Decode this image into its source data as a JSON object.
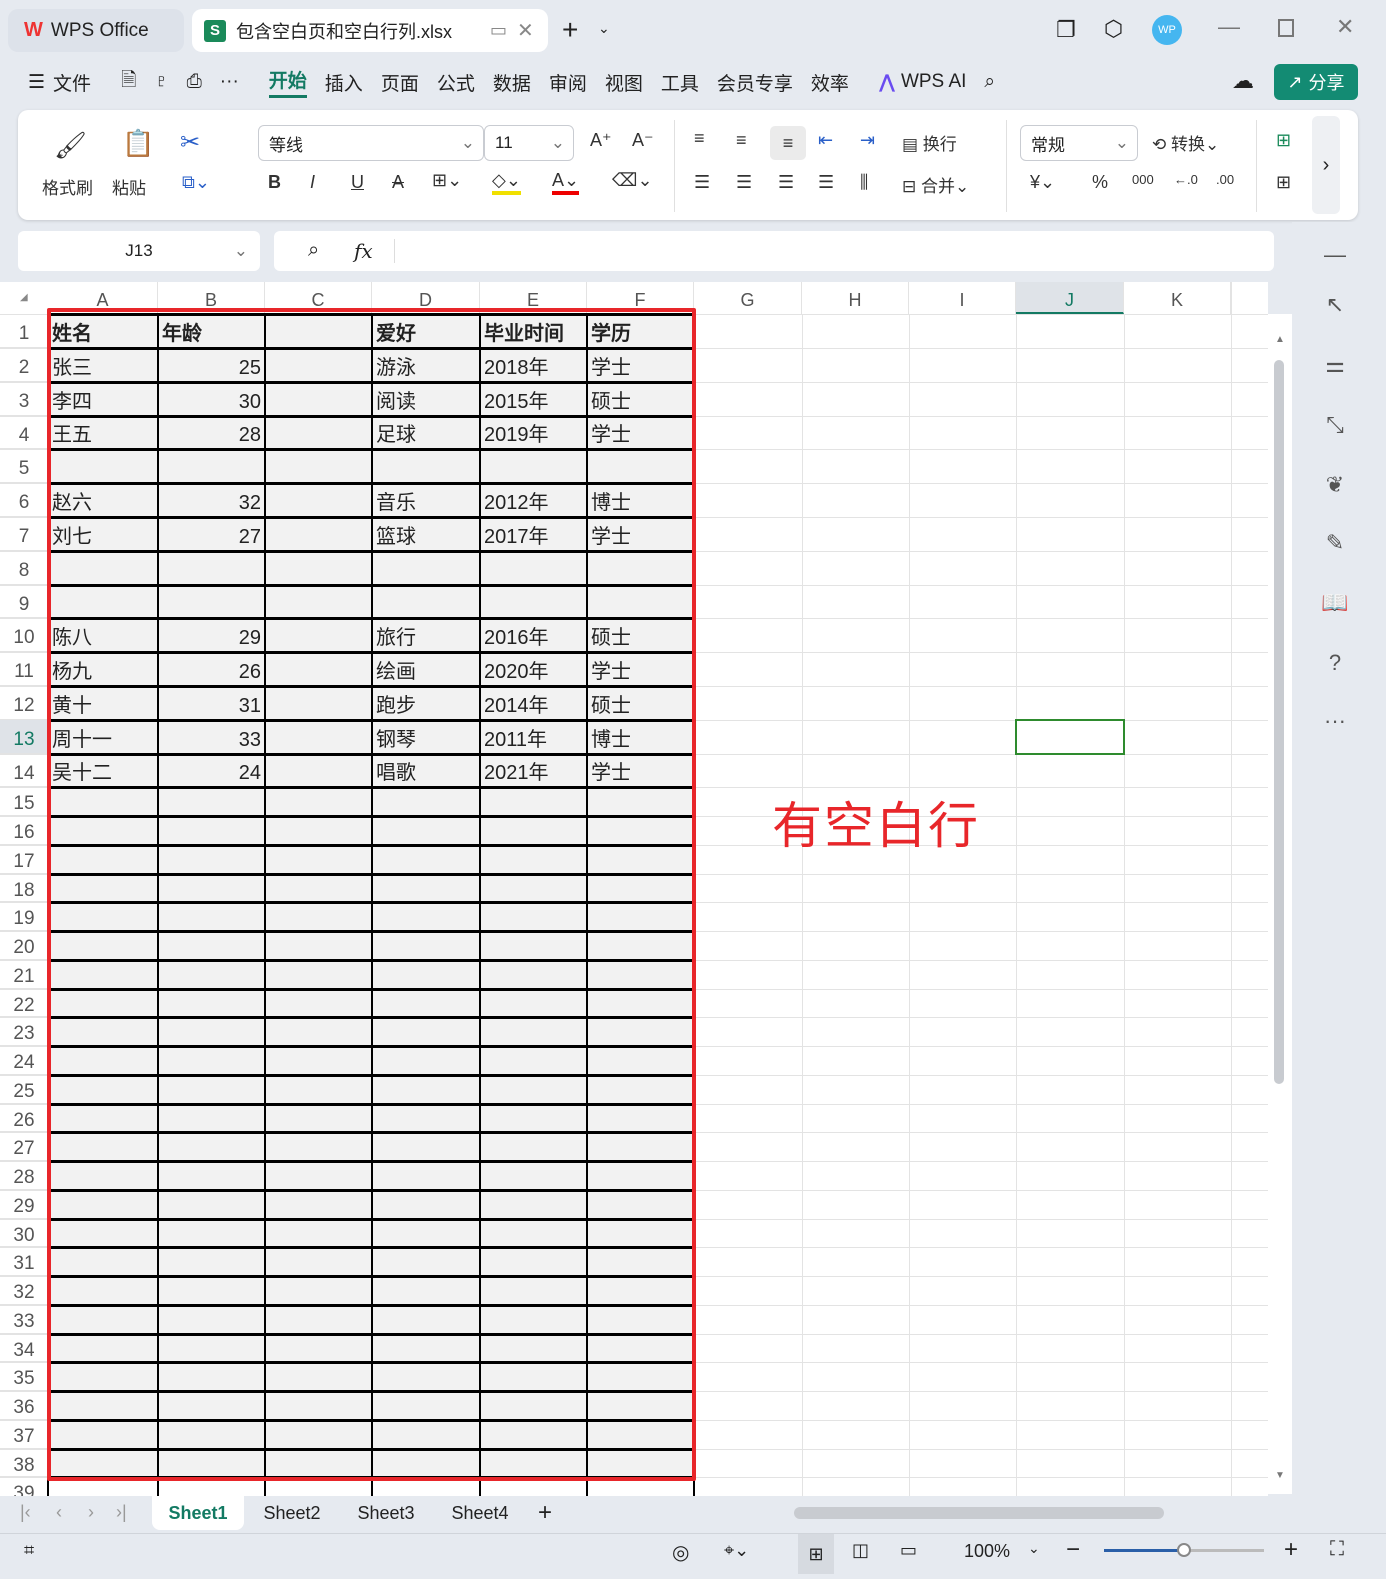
{
  "titlebar": {
    "home_tab": "WPS Office",
    "doc_tab": "包含空白页和空白行列.xlsx",
    "avatar": "WP"
  },
  "menu": {
    "file": "文件",
    "tabs": [
      "开始",
      "插入",
      "页面",
      "公式",
      "数据",
      "审阅",
      "视图",
      "工具",
      "会员专享",
      "效率"
    ],
    "ai": "WPS AI",
    "share": "分享"
  },
  "ribbon": {
    "format_painter": "格式刷",
    "paste": "粘贴",
    "font": "等线",
    "size": "11",
    "wrap": "换行",
    "merge": "合并",
    "number_format": "常规",
    "convert": "转换"
  },
  "formula_bar": {
    "cell_ref": "J13",
    "fx": "fx",
    "value": ""
  },
  "columns": [
    "A",
    "B",
    "C",
    "D",
    "E",
    "F",
    "G",
    "H",
    "I",
    "J",
    "K"
  ],
  "selected_cell": "J13",
  "rows": [
    [
      "姓名",
      "年龄",
      "",
      "爱好",
      "毕业时间",
      "学历"
    ],
    [
      "张三",
      "25",
      "",
      "游泳",
      "2018年",
      "学士"
    ],
    [
      "李四",
      "30",
      "",
      "阅读",
      "2015年",
      "硕士"
    ],
    [
      "王五",
      "28",
      "",
      "足球",
      "2019年",
      "学士"
    ],
    [
      "",
      "",
      "",
      "",
      "",
      ""
    ],
    [
      "赵六",
      "32",
      "",
      "音乐",
      "2012年",
      "博士"
    ],
    [
      "刘七",
      "27",
      "",
      "篮球",
      "2017年",
      "学士"
    ],
    [
      "",
      "",
      "",
      "",
      "",
      ""
    ],
    [
      "",
      "",
      "",
      "",
      "",
      ""
    ],
    [
      "陈八",
      "29",
      "",
      "旅行",
      "2016年",
      "硕士"
    ],
    [
      "杨九",
      "26",
      "",
      "绘画",
      "2020年",
      "学士"
    ],
    [
      "黄十",
      "31",
      "",
      "跑步",
      "2014年",
      "硕士"
    ],
    [
      "周十一",
      "33",
      "",
      "钢琴",
      "2011年",
      "博士"
    ],
    [
      "吴十二",
      "24",
      "",
      "唱歌",
      "2021年",
      "学士"
    ]
  ],
  "annotation": "有空白行",
  "sheets": [
    "Sheet1",
    "Sheet2",
    "Sheet3",
    "Sheet4"
  ],
  "active_sheet": "Sheet1",
  "status": {
    "zoom": "100%",
    "zoom_fraction": 0.5
  },
  "colors": {
    "accent": "#137a63",
    "annotation": "#e8262a",
    "selection": "#2e8b2e"
  }
}
